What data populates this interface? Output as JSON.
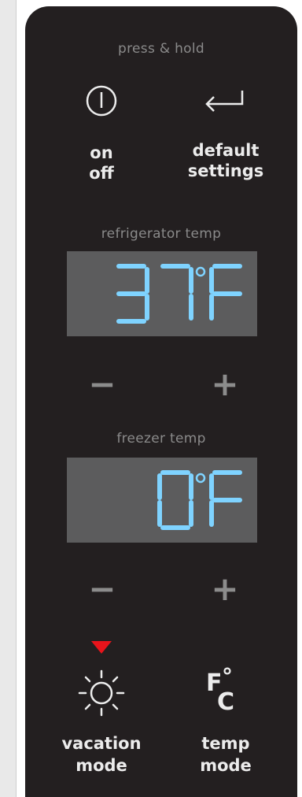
{
  "header": {
    "hint": "press & hold"
  },
  "power": {
    "line1": "on",
    "line2": "off",
    "icon": "power-icon"
  },
  "default_settings": {
    "line1": "default",
    "line2": "settings",
    "icon": "return-arrow-icon"
  },
  "refrigerator": {
    "label": "refrigerator temp",
    "digits": [
      "3",
      "7"
    ],
    "degree": "°",
    "unit": "F",
    "minus": "−",
    "plus": "+"
  },
  "freezer": {
    "label": "freezer temp",
    "digits": [
      "0"
    ],
    "degree": "°",
    "unit": "F",
    "minus": "−",
    "plus": "+"
  },
  "vacation": {
    "line1": "vacation",
    "line2": "mode",
    "icon": "sun-icon",
    "active": true
  },
  "temp_mode": {
    "line1": "temp",
    "line2": "mode",
    "icon": "fahrenheit-celsius-icon",
    "icon_text_f": "F",
    "icon_text_c": "C",
    "icon_text_deg": "°"
  },
  "colors": {
    "panel": "#231f20",
    "display_bg": "#5c5c5d",
    "segment": "#7fd3ff",
    "indicator": "#e8141b"
  }
}
